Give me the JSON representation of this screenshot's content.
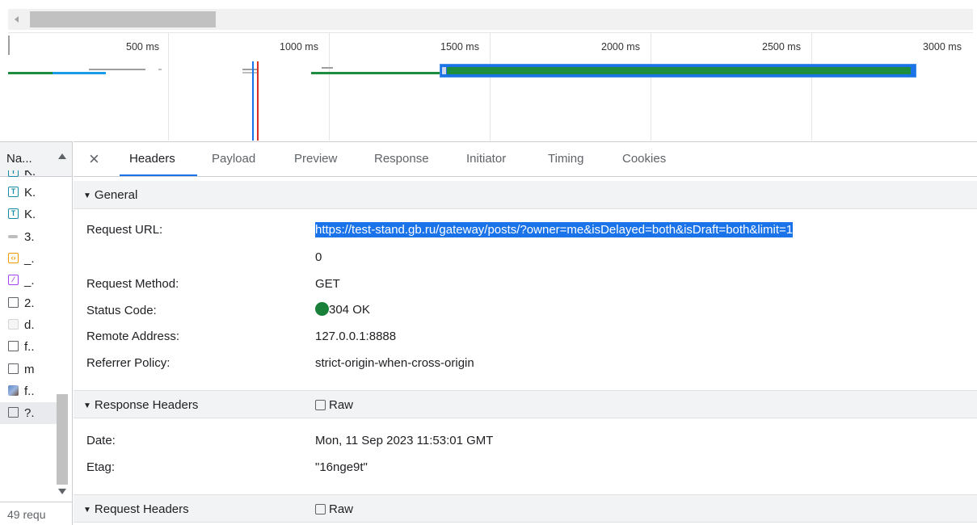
{
  "timeline": {
    "ticks": [
      "500 ms",
      "1000 ms",
      "1500 ms",
      "2000 ms",
      "2500 ms",
      "3000 ms"
    ],
    "colors": {
      "green": "#1e8e3e",
      "blue": "#1a73e8",
      "red": "#d93025"
    }
  },
  "request_list": {
    "header_label": "Na...",
    "items": [
      {
        "icon": "doc-icon",
        "name": "K."
      },
      {
        "icon": "doc-icon",
        "name": "K."
      },
      {
        "icon": "doc-icon",
        "name": "K."
      },
      {
        "icon": "font-icon",
        "name": "3."
      },
      {
        "icon": "script-icon",
        "name": "_."
      },
      {
        "icon": "stylesheet-icon",
        "name": "_."
      },
      {
        "icon": "file-icon",
        "name": "2."
      },
      {
        "icon": "file-light-icon",
        "name": "d."
      },
      {
        "icon": "file-icon",
        "name": "f.."
      },
      {
        "icon": "file-icon",
        "name": "m"
      },
      {
        "icon": "image-icon",
        "name": "f.."
      },
      {
        "icon": "file-icon",
        "name": "?."
      }
    ],
    "footer": "49 requ"
  },
  "tabs": [
    "Headers",
    "Payload",
    "Preview",
    "Response",
    "Initiator",
    "Timing",
    "Cookies"
  ],
  "active_tab": "Headers",
  "general": {
    "title": "General",
    "request_url_label": "Request URL:",
    "request_url": "https://test-stand.gb.ru/gateway/posts/?owner=me&isDelayed=both&isDraft=both&limit=1",
    "request_url_wrap": "0",
    "request_method_label": "Request Method:",
    "request_method": "GET",
    "status_code_label": "Status Code:",
    "status_code": "304 OK",
    "remote_address_label": "Remote Address:",
    "remote_address": "127.0.0.1:8888",
    "referrer_policy_label": "Referrer Policy:",
    "referrer_policy": "strict-origin-when-cross-origin"
  },
  "response_headers": {
    "title": "Response Headers",
    "raw_label": "Raw",
    "date_label": "Date:",
    "date": "Mon, 11 Sep 2023 11:53:01 GMT",
    "etag_label": "Etag:",
    "etag": "\"16nge9t\""
  },
  "request_headers": {
    "title": "Request Headers",
    "raw_label": "Raw"
  }
}
